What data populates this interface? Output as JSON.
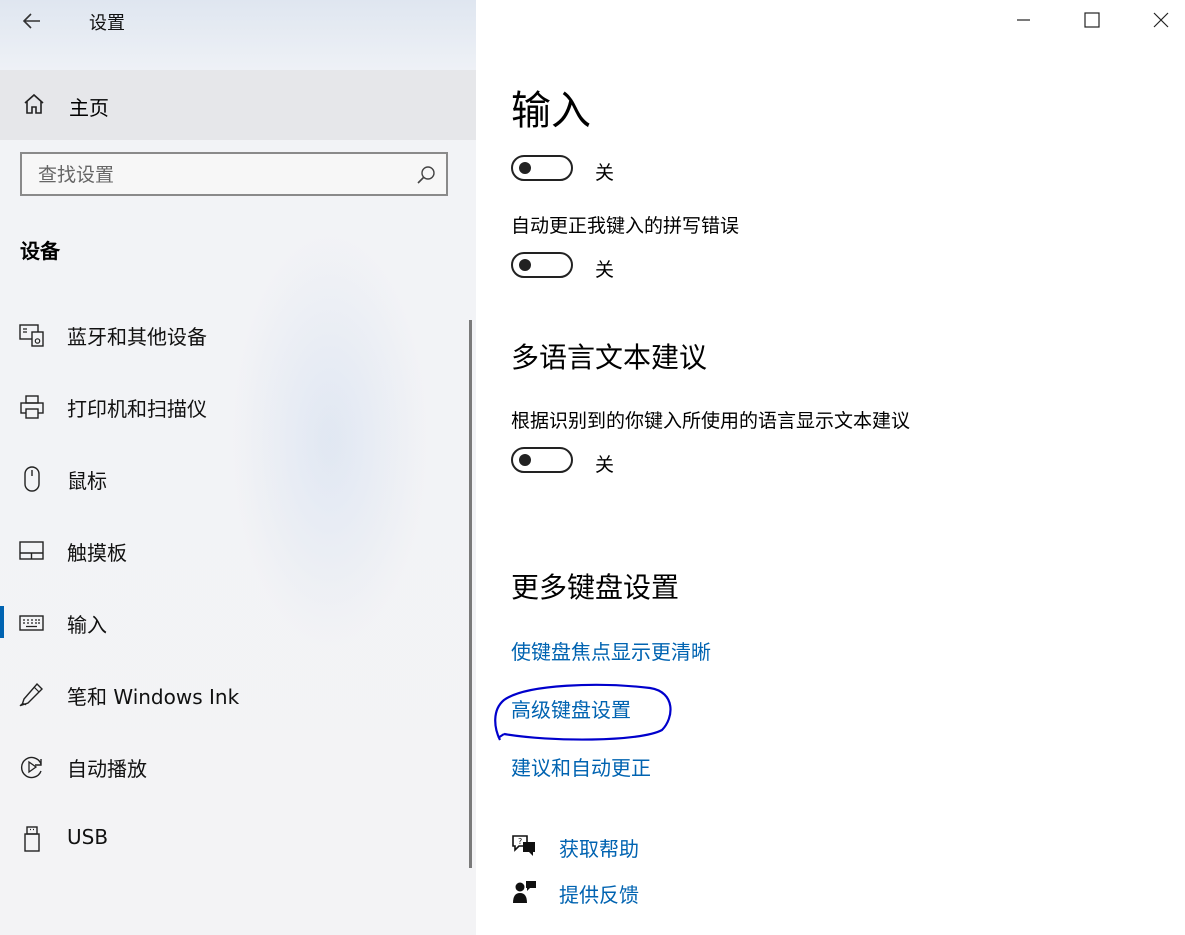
{
  "window": {
    "app_title": "设置",
    "minimize_symbol": "—",
    "maximize_symbol": "☐",
    "close_symbol": "✕"
  },
  "sidebar": {
    "home_label": "主页",
    "search_placeholder": "查找设置",
    "section_title": "设备",
    "items": [
      {
        "label": "蓝牙和其他设备",
        "icon": "bluetooth-devices-icon"
      },
      {
        "label": "打印机和扫描仪",
        "icon": "printer-icon"
      },
      {
        "label": "鼠标",
        "icon": "mouse-icon"
      },
      {
        "label": "触摸板",
        "icon": "touchpad-icon"
      },
      {
        "label": "输入",
        "icon": "keyboard-icon",
        "active": true
      },
      {
        "label": "笔和 Windows Ink",
        "icon": "pen-icon"
      },
      {
        "label": "自动播放",
        "icon": "autoplay-icon"
      },
      {
        "label": "USB",
        "icon": "usb-icon"
      }
    ]
  },
  "main": {
    "page_title": "输入",
    "toggle1_state": "关",
    "autocorrect_label": "自动更正我键入的拼写错误",
    "toggle2_state": "关",
    "multilang_heading": "多语言文本建议",
    "multilang_label": "根据识别到的你键入所使用的语言显示文本建议",
    "toggle3_state": "关",
    "more_keyboard_heading": "更多键盘设置",
    "links": {
      "focus_visuals": "使键盘焦点显示更清晰",
      "advanced_keyboard": "高级键盘设置",
      "suggestions_autocorrect": "建议和自动更正"
    },
    "help": {
      "get_help": "获取帮助",
      "give_feedback": "提供反馈"
    }
  },
  "colors": {
    "accent": "#0063b1",
    "annotation": "#0000cc"
  }
}
